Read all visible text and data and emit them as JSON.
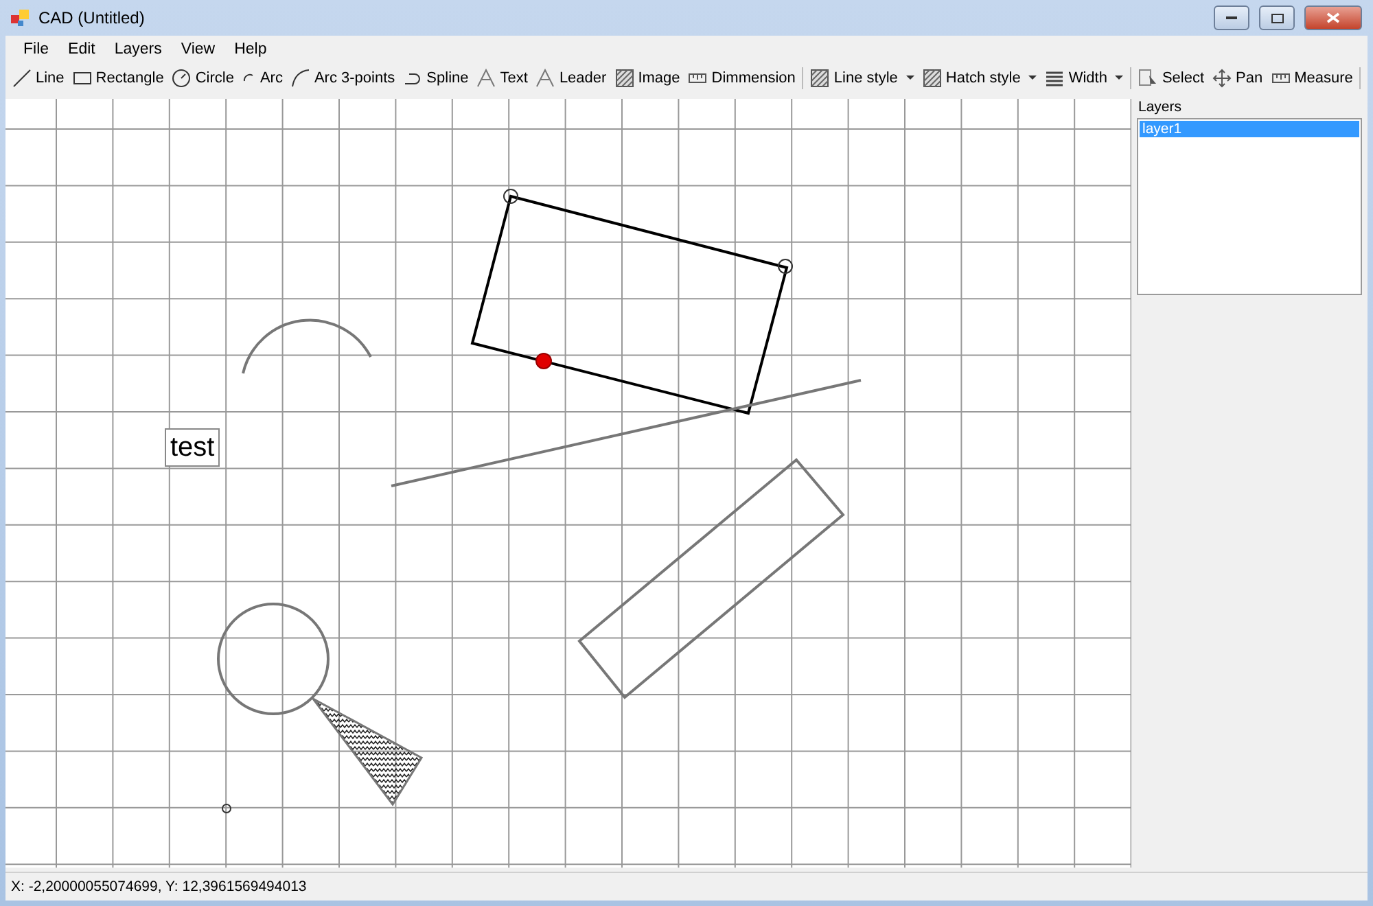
{
  "window": {
    "title": "CAD (Untitled)"
  },
  "menu": [
    "File",
    "Edit",
    "Layers",
    "View",
    "Help"
  ],
  "toolbar": [
    {
      "kind": "tool",
      "label": "Line"
    },
    {
      "kind": "tool",
      "label": "Rectangle"
    },
    {
      "kind": "tool",
      "label": "Circle"
    },
    {
      "kind": "tool",
      "label": "Arc"
    },
    {
      "kind": "tool",
      "label": "Arc 3-points"
    },
    {
      "kind": "tool",
      "label": "Spline"
    },
    {
      "kind": "tool",
      "label": "Text"
    },
    {
      "kind": "tool",
      "label": "Leader"
    },
    {
      "kind": "tool",
      "label": "Image"
    },
    {
      "kind": "tool",
      "label": "Dimmension"
    },
    {
      "kind": "separator"
    },
    {
      "kind": "dropdown",
      "label": "Line style"
    },
    {
      "kind": "dropdown",
      "label": "Hatch style"
    },
    {
      "kind": "dropdown",
      "label": "Width"
    },
    {
      "kind": "separator"
    },
    {
      "kind": "tool",
      "label": "Select"
    },
    {
      "kind": "tool",
      "label": "Pan"
    },
    {
      "kind": "tool",
      "label": "Measure"
    },
    {
      "kind": "separator"
    }
  ],
  "canvas": {
    "text_label": "test"
  },
  "layers": {
    "title": "Layers",
    "items": [
      {
        "label": "layer1",
        "selected": true
      }
    ]
  },
  "status_bar": "X: -2,20000055074699, Y: 12,3961569494013"
}
